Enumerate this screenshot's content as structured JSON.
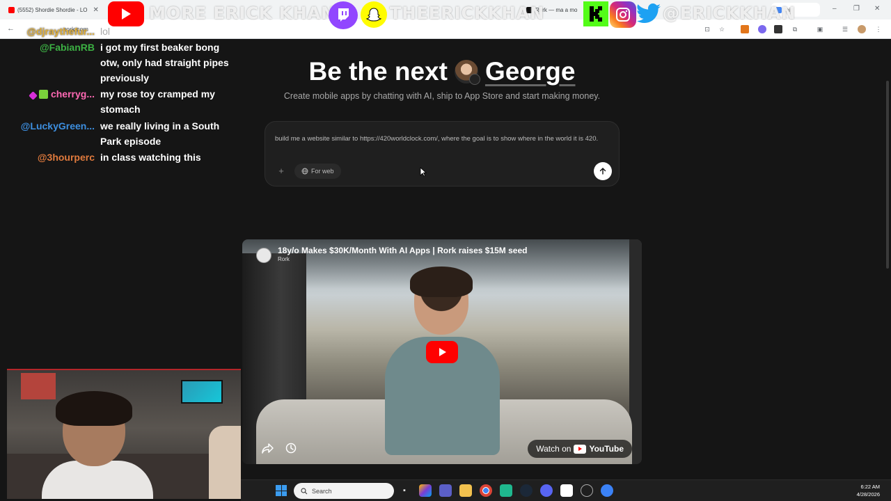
{
  "browser": {
    "tabs": [
      {
        "title": "(5552) Shordie Shordie - LO",
        "fav_color": "#ff0000"
      },
      {
        "title": "Rork — ma a mo",
        "fav_color": "#111111"
      },
      {
        "title": "ini",
        "fav_color": "#4285f4"
      }
    ],
    "omnibox": "rork.com",
    "window_controls": [
      "–",
      "❐",
      "✕"
    ]
  },
  "social_overlay": {
    "handle_youtube": "MORE ERICK KHAN",
    "handle_snapchat": "THEERICKKHAN",
    "handle_twitter": "@ERICKKHAN",
    "icons": [
      "youtube-icon",
      "twitch-icon",
      "snapchat-icon",
      "kick-icon",
      "instagram-icon",
      "twitter-icon"
    ],
    "colors": {
      "youtube": "#ff0000",
      "twitch": "#9146ff",
      "snapchat": "#fffc00",
      "kick": "#53fc18",
      "instagram": "#d62976",
      "twitter": "#1da1f2"
    }
  },
  "chat": {
    "lines": [
      {
        "user": "@djraythefur...",
        "user_color": "#e2b13c",
        "msg": "lol"
      },
      {
        "user": "@FabianRB",
        "user_color": "#3cb043",
        "msg": "i got my first beaker bong otw, only had straight pipes previously"
      },
      {
        "user": "cherryg...",
        "user_color": "#ff69b4",
        "msg": "my rose toy cramped my stomach"
      },
      {
        "user": "@LuckyGreen...",
        "user_color": "#3d8fe0",
        "msg": "we really living in a South Park episode"
      },
      {
        "user": "@3hourperc",
        "user_color": "#e07a3d",
        "msg": "in class watching this"
      }
    ]
  },
  "hero": {
    "title_prefix": "Be the next",
    "title_name": "George",
    "subtitle": "Create mobile apps by chatting with AI, ship to App Store and start making money."
  },
  "prompt": {
    "text": "build me a website similar to https://420worldclock.com/, where the goal is to show where in the world it is 420.",
    "plus_label": "+",
    "for_web_label": "For web"
  },
  "video": {
    "title": "18y/o Makes $30K/Month With AI Apps | Rork raises $15M seed",
    "channel": "Rork",
    "watch_on_label": "Watch on",
    "youtube_label": "YouTube"
  },
  "taskbar": {
    "search_placeholder": "Search",
    "time": "6:22 AM",
    "date": "4/28/2026"
  }
}
